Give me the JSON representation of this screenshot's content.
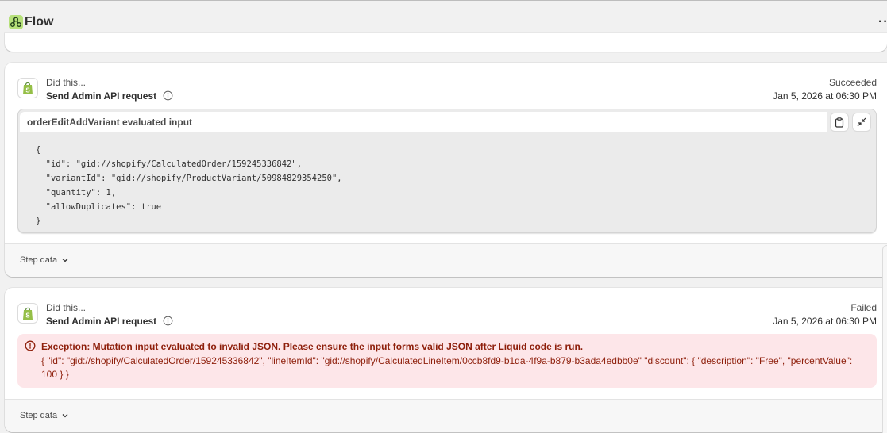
{
  "app": {
    "title": "Flow",
    "more_label": "···"
  },
  "steps": [
    {
      "label": "Did this...",
      "title": "Send Admin API request",
      "status": "Succeeded",
      "timestamp": "Jan 5, 2026 at 06:30 PM",
      "input_title": "orderEditAddVariant evaluated input",
      "code": "{\n  \"id\": \"gid://shopify/CalculatedOrder/159245336842\",\n  \"variantId\": \"gid://shopify/ProductVariant/50984829354250\",\n  \"quantity\": 1,\n  \"allowDuplicates\": true\n}",
      "footer_label": "Step data"
    },
    {
      "label": "Did this...",
      "title": "Send Admin API request",
      "status": "Failed",
      "timestamp": "Jan 5, 2026 at 06:30 PM",
      "error_title": "Exception: Mutation input evaluated to invalid JSON. Please ensure the input forms valid JSON after Liquid code is run.",
      "error_detail": "{ \"id\": \"gid://shopify/CalculatedOrder/159245336842\", \"lineItemId\": \"gid://shopify/CalculatedLineItem/0ccb8fd9-b1da-4f9a-b879-b3ada4edbb0e\" \"discount\": { \"description\": \"Free\", \"percentValue\": 100 } }",
      "footer_label": "Step data"
    }
  ],
  "colors": {
    "background": "#f1f1f1",
    "error_background": "#fde6e9",
    "error_text": "#8e1f0b",
    "shopify_green": "#95bf47"
  }
}
